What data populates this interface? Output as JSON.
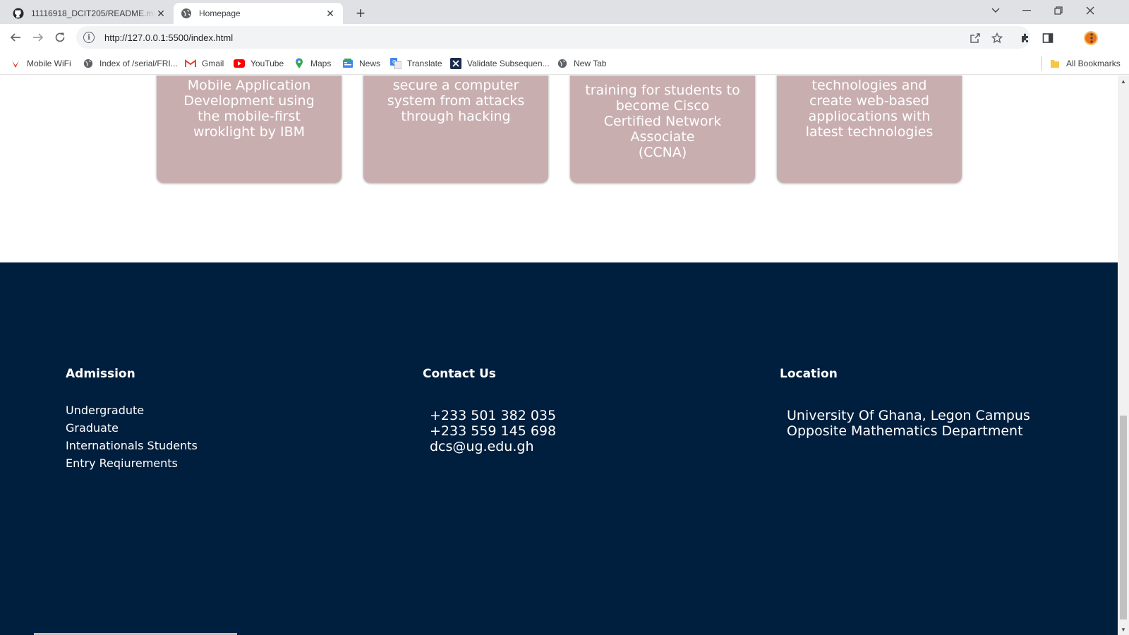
{
  "browser": {
    "tabs": [
      {
        "title": "11116918_DCIT205/README.md",
        "icon": "github-icon"
      },
      {
        "title": "Homepage",
        "icon": "globe-icon"
      }
    ],
    "url": "http://127.0.0.1:5500/index.html",
    "bookmarks": [
      {
        "label": "Mobile WiFi",
        "icon": "huawei-icon"
      },
      {
        "label": "Index of /serial/FRI...",
        "icon": "globe-icon"
      },
      {
        "label": "Gmail",
        "icon": "gmail-icon"
      },
      {
        "label": "YouTube",
        "icon": "youtube-icon"
      },
      {
        "label": "Maps",
        "icon": "maps-icon"
      },
      {
        "label": "News",
        "icon": "news-icon"
      },
      {
        "label": "Translate",
        "icon": "translate-icon"
      },
      {
        "label": "Validate Subsequen...",
        "icon": "validate-icon"
      },
      {
        "label": "New Tab",
        "icon": "globe-icon"
      }
    ],
    "all_bookmarks": "All Bookmarks"
  },
  "cards": [
    {
      "lines": [
        "Mobile Application",
        "Development using",
        "the mobile-first",
        "wroklight by IBM"
      ]
    },
    {
      "lines": [
        "secure a computer",
        "system from attacks",
        "through hacking"
      ]
    },
    {
      "lines": [
        "training for students to",
        "become Cisco",
        "Certified Network",
        "Associate",
        "(CCNA)"
      ]
    },
    {
      "lines": [
        "technologies and",
        "create web-based",
        "appliocations with",
        "latest technologies"
      ]
    }
  ],
  "footer": {
    "admission": {
      "heading": "Admission",
      "links": [
        "Undergradute",
        "Graduate",
        "Internationals Students",
        "Entry Reqiurements"
      ]
    },
    "contact": {
      "heading": "Contact Us",
      "phone1": "+233 501 382 035",
      "phone2": "+233 559 145 698",
      "email": "dcs@ug.edu.gh"
    },
    "location": {
      "heading": "Location",
      "line1": "University Of Ghana, Legon Campus",
      "line2": "Opposite Mathematics Department"
    }
  },
  "colors": {
    "card_bg": "#c9aeb0",
    "footer_bg": "#001e3d",
    "text_on_dark": "#ffffff"
  }
}
